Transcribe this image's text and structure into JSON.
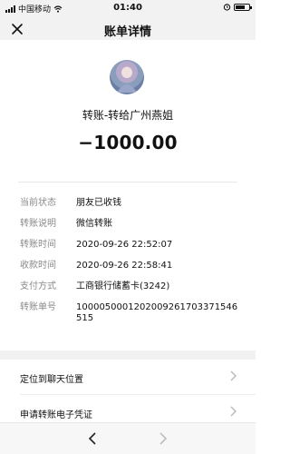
{
  "status": {
    "carrier": "中国移动",
    "time": "01:40"
  },
  "nav": {
    "title": "账单详情",
    "close_icon": "close-icon"
  },
  "transfer": {
    "headline": "转账-转给广州燕姐",
    "amount": "−1000.00"
  },
  "details": [
    {
      "label": "当前状态",
      "value": "朋友已收钱"
    },
    {
      "label": "转账说明",
      "value": "微信转账"
    },
    {
      "label": "转账时间",
      "value": "2020-09-26 22:52:07"
    },
    {
      "label": "收款时间",
      "value": "2020-09-26 22:58:41"
    },
    {
      "label": "支付方式",
      "value": "工商银行储蓄卡(3242)"
    },
    {
      "label": "转账单号",
      "value": "1000050001202009261703371546515"
    }
  ],
  "actions": [
    {
      "label": "定位到聊天位置"
    },
    {
      "label": "申请转账电子凭证"
    }
  ],
  "bottom": {
    "back_icon": "chevron-left-icon",
    "forward_icon": "chevron-right-icon"
  }
}
